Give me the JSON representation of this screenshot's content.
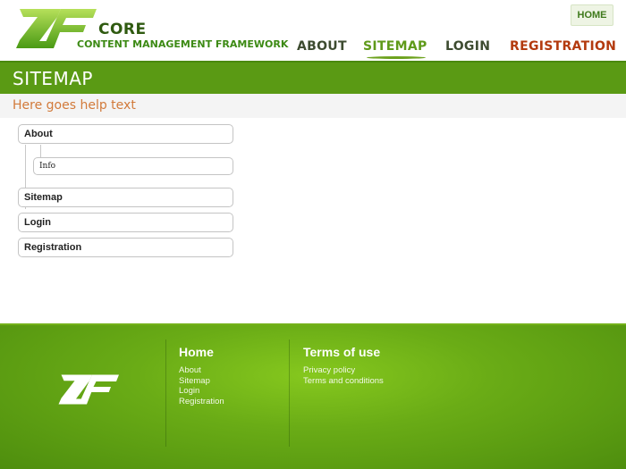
{
  "header": {
    "logo": {
      "core": "CORE",
      "subtitle": "CONTENT MANAGEMENT FRAMEWORK",
      "icon": "zf-logo-icon"
    },
    "home_button": "HOME",
    "nav": {
      "about": "ABOUT",
      "sitemap": "SITEMAP",
      "login": "LOGIN",
      "registration": "REGISTRATION"
    }
  },
  "title": "SITEMAP",
  "help_text": "Here goes help text",
  "tree": {
    "about": "About",
    "info": "Info",
    "sitemap": "Sitemap",
    "login": "Login",
    "registration": "Registration"
  },
  "footer": {
    "logo_icon": "zf-logo-icon",
    "home": {
      "heading": "Home",
      "links": [
        "About",
        "Sitemap",
        "Login",
        "Registration"
      ]
    },
    "terms": {
      "heading": "Terms of use",
      "links": [
        "Privacy policy",
        "Terms and conditions"
      ]
    }
  },
  "colors": {
    "brand_green": "#5a9a14",
    "nav_active": "#5f9a1a",
    "nav_registration": "#b33a0e",
    "help_text": "#d27a3a"
  }
}
